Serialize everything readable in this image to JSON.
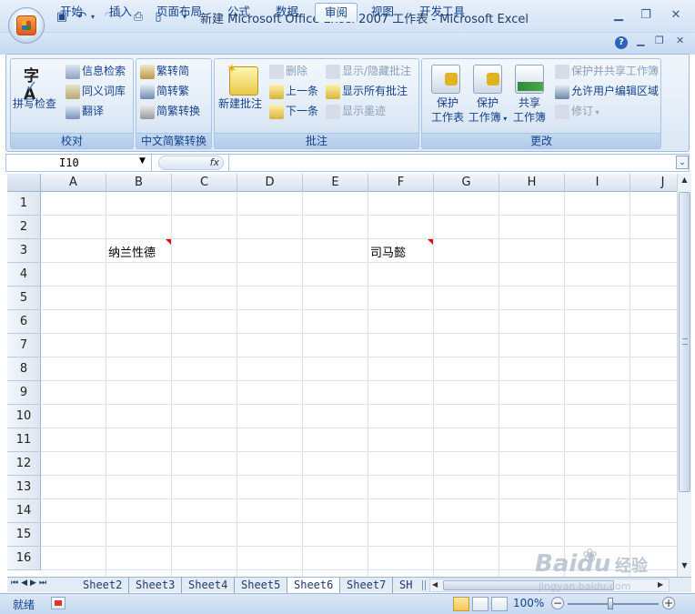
{
  "window": {
    "title": "新建 Microsoft Office Excel 2007 工作表 - Microsoft Excel"
  },
  "tabs": [
    "开始",
    "插入",
    "页面布局",
    "公式",
    "数据",
    "审阅",
    "视图",
    "开发工具"
  ],
  "active_tab": "审阅",
  "ribbon": {
    "proofing": {
      "label": "校对",
      "spellcheck": "拼写检查",
      "research": "信息检索",
      "thesaurus": "同义词库",
      "translate": "翻译"
    },
    "chinese_conversion": {
      "label": "中文简繁转换",
      "to_simplified": "繁转简",
      "to_traditional": "简转繁",
      "convert": "简繁转换"
    },
    "comments": {
      "label": "批注",
      "new": "新建批注",
      "delete": "删除",
      "previous": "上一条",
      "next": "下一条",
      "show_hide": "显示/隐藏批注",
      "show_all": "显示所有批注",
      "show_ink": "显示墨迹"
    },
    "changes": {
      "label": "更改",
      "protect_sheet_1": "保护",
      "protect_sheet_2": "工作表",
      "protect_workbook_1": "保护",
      "protect_workbook_2": "工作簿",
      "share_workbook_1": "共享",
      "share_workbook_2": "工作簿",
      "protect_share": "保护并共享工作簿",
      "allow_edit": "允许用户编辑区域",
      "track_changes": "修订"
    }
  },
  "formula_bar": {
    "name_box": "I10",
    "fx": "fx",
    "value": ""
  },
  "grid": {
    "columns": [
      "A",
      "B",
      "C",
      "D",
      "E",
      "F",
      "G",
      "H",
      "I",
      "J"
    ],
    "rows": [
      "1",
      "2",
      "3",
      "4",
      "5",
      "6",
      "7",
      "8",
      "9",
      "10",
      "11",
      "12",
      "13",
      "14",
      "15",
      "16"
    ],
    "cells": {
      "B3": "纳兰性德",
      "F3": "司马懿"
    }
  },
  "sheets": [
    "Sheet2",
    "Sheet3",
    "Sheet4",
    "Sheet5",
    "Sheet6",
    "Sheet7",
    "SH"
  ],
  "active_sheet": "Sheet6",
  "status": {
    "ready": "就绪",
    "zoom": "100%"
  },
  "watermark": {
    "brand": "Baidu",
    "text": "经验",
    "url": "jingyan.baidu.com"
  }
}
